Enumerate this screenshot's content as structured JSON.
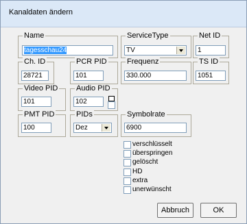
{
  "window": {
    "title": "Kanaldaten ändern"
  },
  "fields": {
    "name": {
      "label": "Name",
      "value": "tagesschau24"
    },
    "service_type": {
      "label": "ServiceType",
      "value": "TV"
    },
    "net_id": {
      "label": "Net ID",
      "value": "1"
    },
    "ch_id": {
      "label": "Ch. ID",
      "value": "28721"
    },
    "pcr_pid": {
      "label": "PCR PID",
      "value": "101"
    },
    "frequenz": {
      "label": "Frequenz",
      "value": "330.000"
    },
    "ts_id": {
      "label": "TS ID",
      "value": "1051"
    },
    "video_pid": {
      "label": "Video PID",
      "value": "101"
    },
    "audio_pid": {
      "label": "Audio PID",
      "value": "102"
    },
    "pmt_pid": {
      "label": "PMT PID",
      "value": "100"
    },
    "pids": {
      "label": "PIDs",
      "value": "Dez"
    },
    "symbolrate": {
      "label": "Symbolrate",
      "value": "6900"
    }
  },
  "checkboxes": [
    {
      "label": "verschlüsselt",
      "checked": false
    },
    {
      "label": "überspringen",
      "checked": false
    },
    {
      "label": "gelöscht",
      "checked": false
    },
    {
      "label": "HD",
      "checked": false
    },
    {
      "label": "extra",
      "checked": false
    },
    {
      "label": "unerwünscht",
      "checked": false
    }
  ],
  "buttons": {
    "cancel": "Abbruch",
    "ok": "OK"
  }
}
